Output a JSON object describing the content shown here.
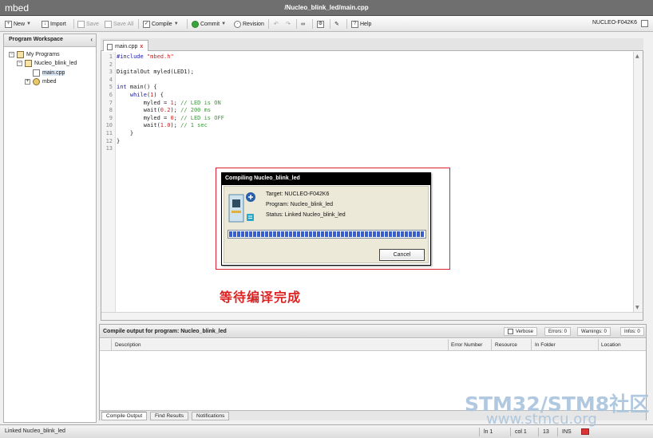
{
  "app": {
    "name": "mbed",
    "path": "/Nucleo_blink_led/main.cpp"
  },
  "toolbar": {
    "new": "New",
    "import": "Import",
    "save": "Save",
    "save_all": "Save All",
    "compile": "Compile",
    "commit": "Commit",
    "revision": "Revision",
    "help": "Help",
    "target": "NUCLEO-F042K6"
  },
  "workspace": {
    "title": "Program Workspace",
    "tree": [
      {
        "label": "My Programs"
      },
      {
        "label": "Nucleo_blink_led"
      },
      {
        "label": "main.cpp"
      },
      {
        "label": "mbed"
      }
    ]
  },
  "editor": {
    "tab": "main.cpp",
    "line_numbers": [
      "1",
      "2",
      "3",
      "4",
      "5",
      "6",
      "7",
      "8",
      "9",
      "10",
      "11",
      "12",
      "13"
    ],
    "code": [
      "#include \"mbed.h\"",
      "",
      "DigitalOut myled(LED1);",
      "",
      "int main() {",
      "    while(1) {",
      "        myled = 1; // LED is ON",
      "        wait(0.2); // 200 ms",
      "        myled = 0; // LED is OFF",
      "        wait(1.0); // 1 sec",
      "    }",
      "}",
      ""
    ]
  },
  "dialog": {
    "title": "Compiling Nucleo_blink_led",
    "target": "Target: NUCLEO-F042K6",
    "program": "Program: Nucleo_blink_led",
    "status": "Status: Linked Nucleo_blink_led",
    "progress": 1.0,
    "cancel": "Cancel"
  },
  "annotation": "等待编译完成",
  "output": {
    "title": "Compile output for program: Nucleo_blink_led",
    "verbose": "Verbose",
    "errors": "Errors: 0",
    "warnings": "Warnings: 0",
    "infos": "Infos: 0",
    "columns": [
      "Description",
      "Error Number",
      "Resource",
      "In Folder",
      "Location"
    ],
    "tabs": [
      "Compile Output",
      "Find Results",
      "Notifications"
    ]
  },
  "status": {
    "message": "Linked Nucleo_blink_led",
    "line": "ln 1",
    "col": "col 1",
    "count": "13",
    "mode": "INS"
  },
  "watermark": {
    "line1": "STM32/STM8社区",
    "line2": "www.stmcu.org"
  },
  "colors": {
    "highlight": "#dd2222",
    "progress": "#3a5fc8",
    "titlebar": "#6f6f6f"
  }
}
